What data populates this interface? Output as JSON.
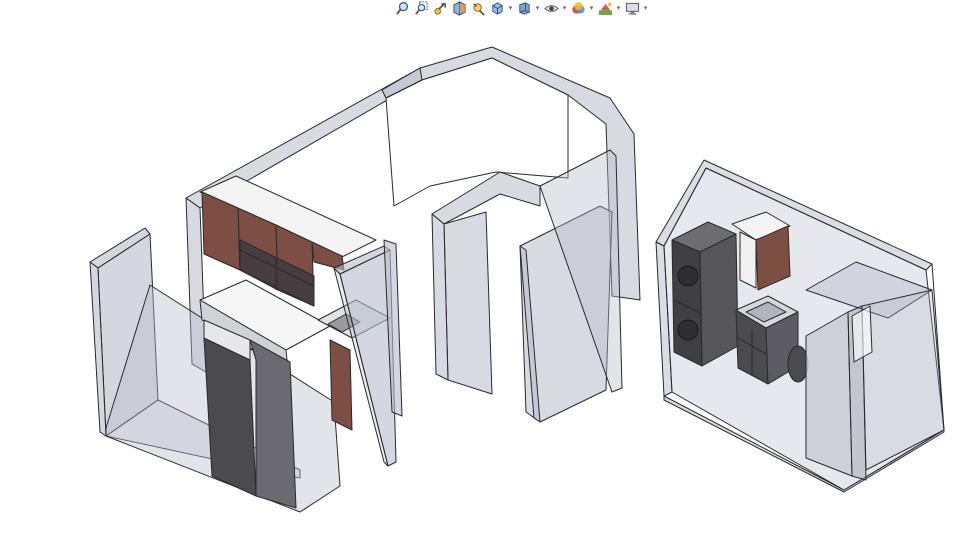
{
  "app": {
    "window_title": ""
  },
  "heads_up_toolbar": {
    "buttons": [
      {
        "name": "zoom-to-fit",
        "icon": "magnifier-icon"
      },
      {
        "name": "zoom-to-area",
        "icon": "zoom-area-icon"
      },
      {
        "name": "previous-view",
        "icon": "previous-view-icon"
      },
      {
        "name": "section-view",
        "icon": "section-view-icon"
      },
      {
        "name": "dynamic-annotation-views",
        "icon": "annotation-icon"
      },
      {
        "name": "view-orientation",
        "icon": "view-orientation-cube-icon",
        "dropdown": true
      },
      {
        "name": "display-style",
        "icon": "display-style-icon",
        "dropdown": true
      },
      {
        "name": "hide-show-items",
        "icon": "eye-icon",
        "dropdown": true
      },
      {
        "name": "edit-appearance",
        "icon": "appearance-sphere-icon",
        "dropdown": true
      },
      {
        "name": "apply-scene",
        "icon": "scene-icon",
        "dropdown": true
      },
      {
        "name": "view-settings",
        "icon": "monitor-icon",
        "dropdown": true
      }
    ]
  },
  "colors": {
    "background": "#ffffff",
    "wall_fill": "#b8bccb",
    "wall_edge": "#2a2a2a",
    "cabinet_wood": "#7d4e44",
    "appliance_dark": "#4a4a4f"
  },
  "model": {
    "components": [
      "kitchen-walls",
      "upper-cabinets",
      "base-cabinets",
      "refrigerator",
      "cooktop",
      "washer",
      "dryer",
      "vanity-sink",
      "medicine-cabinet",
      "shower-enclosure",
      "toilet",
      "bathroom-walls",
      "bay-window-wall"
    ]
  }
}
